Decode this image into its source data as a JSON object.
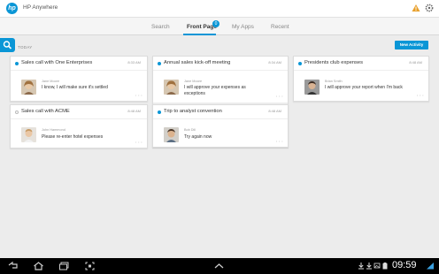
{
  "app": {
    "title": "HP Anywhere",
    "logo_text": "hp"
  },
  "tabs": [
    {
      "label": "Search"
    },
    {
      "label": "Front Page"
    },
    {
      "label": "My Apps"
    },
    {
      "label": "Recent"
    }
  ],
  "front_page_badge": "0",
  "section_label": "TODAY",
  "new_activity_label": "New Activity",
  "cards": [
    {
      "title": "Sales call with One Enterprises",
      "time": "8:33 AM",
      "unread": true,
      "sender": "Jane Moore",
      "message": "I know, I will make sure it's settled"
    },
    {
      "title": "Annual sales kick-off meeting",
      "time": "8:34 AM",
      "unread": true,
      "sender": "Jane Moore",
      "message": "I will approve your expenses as exceptions"
    },
    {
      "title": "Presidents club expenses",
      "time": "8:48 AM",
      "unread": true,
      "sender": "Brian Smith",
      "message": "I will approve your report when I'm back"
    },
    {
      "title": "Sales call with ACME",
      "time": "8:48 AM",
      "unread": false,
      "sender": "John Hammond",
      "message": "Please re-enter hotel expenses"
    },
    {
      "title": "Trip to analyst convention",
      "time": "8:48 AM",
      "unread": true,
      "sender": "Bob Dill",
      "message": "Try again now"
    }
  ],
  "status_bar": {
    "clock": "09:59"
  },
  "colors": {
    "accent": "#0a96d6",
    "background": "#ececec",
    "navbar": "#000000"
  }
}
